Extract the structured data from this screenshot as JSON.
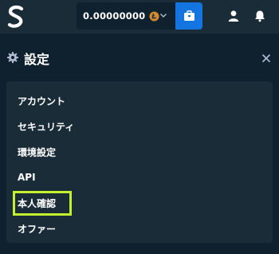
{
  "app": {
    "logo_icon": "stake-s-logo-icon"
  },
  "wallet": {
    "balance": "0.00000000",
    "currency_icon": "litecoin-icon",
    "dropdown_icon": "chevron-down-icon",
    "wallet_button_icon": "wallet-icon",
    "accent_color": "#1475e1"
  },
  "topbar_actions": {
    "user_icon": "user-icon",
    "notification_icon": "bell-icon"
  },
  "settings": {
    "title": "設定",
    "title_icon": "gear-icon",
    "close_icon": "close-icon",
    "menu": [
      {
        "label": "アカウント",
        "selected": false
      },
      {
        "label": "セキュリティ",
        "selected": false
      },
      {
        "label": "環境設定",
        "selected": false
      },
      {
        "label": "API",
        "selected": false
      },
      {
        "label": "本人確認",
        "selected": true
      },
      {
        "label": "オファー",
        "selected": false
      }
    ],
    "highlight_color": "#c4f02f"
  }
}
